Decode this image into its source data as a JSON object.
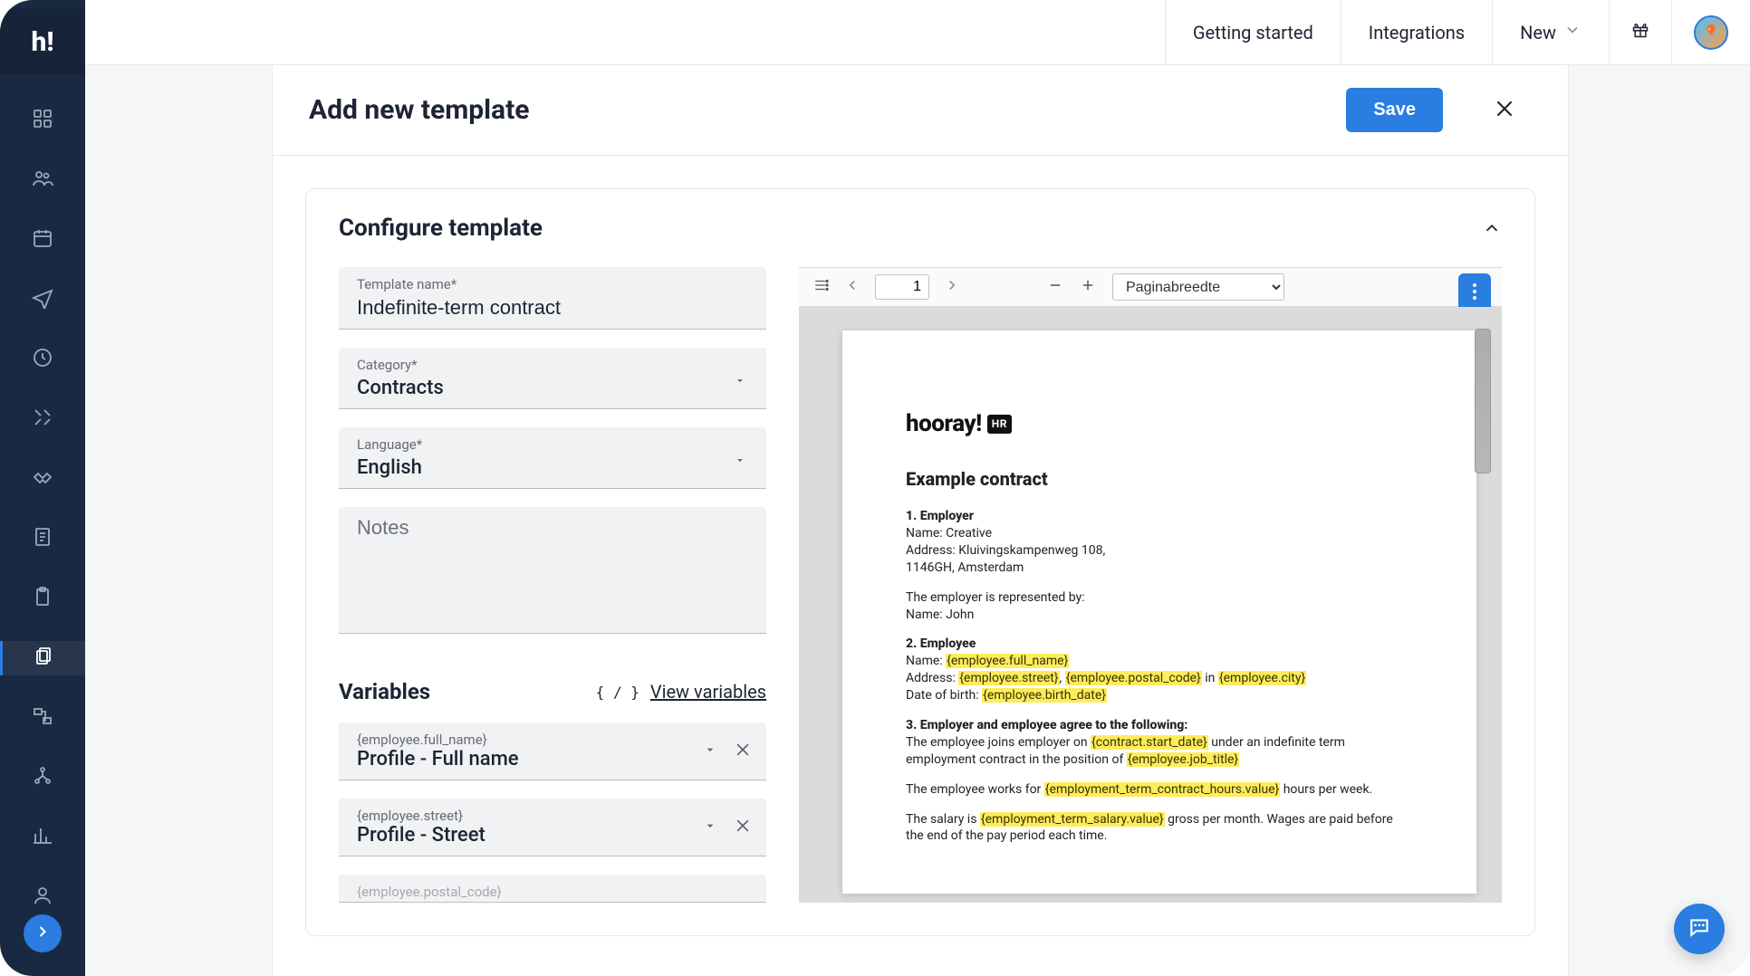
{
  "brand_logo_text": "h!",
  "topbar": {
    "getting_started": "Getting started",
    "integrations": "Integrations",
    "new": "New"
  },
  "page": {
    "title": "Add new template",
    "save_label": "Save"
  },
  "section": {
    "title": "Configure template"
  },
  "form": {
    "template_name_label": "Template name*",
    "template_name_value": "Indefinite-term contract",
    "category_label": "Category*",
    "category_value": "Contracts",
    "language_label": "Language*",
    "language_value": "English",
    "notes_placeholder": "Notes"
  },
  "variables": {
    "title": "Variables",
    "braces": "{ / }",
    "view_link": "View variables",
    "items": [
      {
        "code": "{employee.full_name}",
        "label": "Profile - Full name"
      },
      {
        "code": "{employee.street}",
        "label": "Profile - Street"
      },
      {
        "code_partial": "{employee.postal_code}"
      }
    ]
  },
  "pdf_toolbar": {
    "page_number": "1",
    "zoom_label": "Paginabreedte"
  },
  "pdf": {
    "brand_main": "hooray!",
    "brand_badge": "HR",
    "heading": "Example contract",
    "sec1_title": "1. Employer",
    "sec1_name": "Name: Creative",
    "sec1_address_line1": "Address: Kluivingskampenweg 108,",
    "sec1_address_line2": "1146GH, Amsterdam",
    "sec1_rep_line": "The employer is represented by:",
    "sec1_rep_name": "Name: John",
    "sec2_title": "2. Employee",
    "sec2_name_prefix": "Name: ",
    "sec2_name_var": "{employee.full_name}",
    "sec2_addr_prefix": "Address: ",
    "sec2_addr_var1": "{employee.street}",
    "sec2_addr_sep": ", ",
    "sec2_addr_var2": "{employee.postal_code}",
    "sec2_addr_in": " in ",
    "sec2_addr_var3": "{employee.city}",
    "sec2_dob_prefix": "Date of birth: ",
    "sec2_dob_var": "{employee.birth_date}",
    "sec3_title": "3. Employer and employee agree to the following:",
    "sec3_p1_a": "The employee joins employer on ",
    "sec3_p1_var1": "{contract.start_date}",
    "sec3_p1_b": " under an indefinite term employment contract in the position of ",
    "sec3_p1_var2": "{employee.job_title}",
    "sec3_p2_a": "The employee works for ",
    "sec3_p2_var": "{employment_term_contract_hours.value}",
    "sec3_p2_b": " hours per week.",
    "sec3_p3_a": "The salary is ",
    "sec3_p3_var": "{employment_term_salary.value}",
    "sec3_p3_b": " gross per month. Wages are paid before the end of the pay period each time."
  }
}
